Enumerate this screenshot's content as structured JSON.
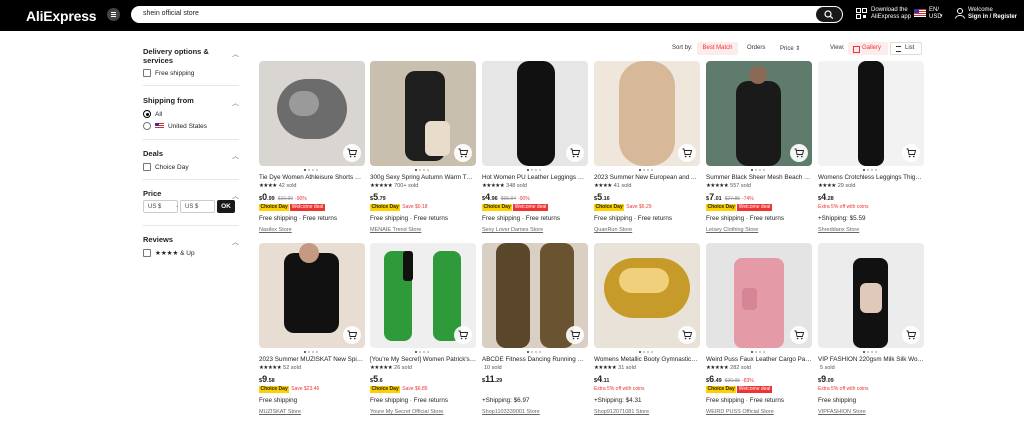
{
  "header": {
    "logo": "AliExpress",
    "search_value": "shein official store",
    "app_line1": "Download the",
    "app_line2": "AliExpress app",
    "lang": "EN/",
    "currency": "USD",
    "welcome": "Welcome",
    "signin": "Sign in / Register"
  },
  "sidebar": {
    "delivery_title_1": "Delivery options &",
    "delivery_title_2": "services",
    "free_shipping": "Free shipping",
    "ship_from_title": "Shipping from",
    "ship_all": "All",
    "ship_us": "United States",
    "deals_title": "Deals",
    "choice_day": "Choice Day",
    "price_title": "Price",
    "price_min_placeholder": "US $",
    "price_max_placeholder": "US $",
    "ok": "OK",
    "reviews_title": "Reviews",
    "reviews_opt": "★★★★ & Up"
  },
  "sortbar": {
    "sort_by": "Sort by:",
    "best_match": "Best Match",
    "orders": "Orders",
    "price": "Price ⇕",
    "view": "View:",
    "gallery": "Gallery",
    "list": "List"
  },
  "products": [
    {
      "title": "Tie Dye Women Athleisure Shorts S…",
      "stars": "★★★★",
      "sold": "42 sold",
      "cur": "$",
      "int": "0",
      "cents": ".99",
      "old": "$16.99",
      "disc": "-90%",
      "badge": "welcome",
      "save": "",
      "ship": "Free shipping · Free returns",
      "store": "Nasilex Store"
    },
    {
      "title": "300g Sexy Spring Autumn Warm Th…",
      "stars": "★★★★★",
      "sold": "700+ sold",
      "cur": "$",
      "int": "5",
      "cents": ".79",
      "old": "",
      "disc": "",
      "badge": "save",
      "save": "Save $0.18",
      "ship": "Free shipping · Free returns",
      "store": "MENAIE Trend Store"
    },
    {
      "title": "Hot Women PU Leather Leggings Bl…",
      "stars": "★★★★★",
      "sold": "348 sold",
      "cur": "$",
      "int": "4",
      "cents": ".96",
      "old": "$65.94",
      "disc": "-90%",
      "badge": "welcome",
      "save": "",
      "ship": "Free shipping · Free returns",
      "store": "Sexy Lover Dames Store"
    },
    {
      "title": "2023 Summer New European and A…",
      "stars": "★★★★",
      "sold": "41 sold",
      "cur": "$",
      "int": "5",
      "cents": ".16",
      "old": "",
      "disc": "",
      "badge": "save",
      "save": "Save $6.29",
      "ship": "Free shipping · Free returns",
      "store": "QuanRun Store"
    },
    {
      "title": "Summer Black Sheer Mesh Beach D…",
      "stars": "★★★★★",
      "sold": "557 sold",
      "cur": "$",
      "int": "7",
      "cents": ".01",
      "old": "$27.85",
      "disc": "-74%",
      "badge": "welcome",
      "save": "",
      "ship": "Free shipping · Free returns",
      "store": "Leisey Clothing Store"
    },
    {
      "title": "Womens Crotchless Leggings Thigh …",
      "stars": "★★★★",
      "sold": "29 sold",
      "cur": "$",
      "int": "4",
      "cents": ".28",
      "old": "",
      "disc": "",
      "badge": "extra",
      "save": "Extra 5% off with coins",
      "ship": "+Shipping: $5.59",
      "store": "Shreddanx Store"
    },
    {
      "title": "2023 Summer MUZISKAT New Spice…",
      "stars": "★★★★★",
      "sold": "52 sold",
      "cur": "$",
      "int": "9",
      "cents": ".58",
      "old": "",
      "disc": "",
      "badge": "save",
      "save": "Save $23.46",
      "ship": "Free shipping",
      "store": "MUZISKAT Store"
    },
    {
      "title": "[You're My Secret] Women Patrick's…",
      "stars": "★★★★★",
      "sold": "26 sold",
      "cur": "$",
      "int": "5",
      "cents": ".6",
      "old": "",
      "disc": "",
      "badge": "save",
      "save": "Save $6.85",
      "ship": "Free shipping · Free returns",
      "store": "Youre My Secret Official Store"
    },
    {
      "title": "ABCDE Fitness Dancing Running Cas…",
      "stars": "",
      "sold": "10 sold",
      "cur": "$",
      "int": "11",
      "cents": ".29",
      "old": "",
      "disc": "",
      "badge": "",
      "save": "",
      "ship": "+Shipping: $6.97",
      "store": "Shop1103339001 Store"
    },
    {
      "title": "Womens Metallic Booty Gymnastics …",
      "stars": "★★★★★",
      "sold": "31 sold",
      "cur": "$",
      "int": "4",
      "cents": ".11",
      "old": "",
      "disc": "",
      "badge": "extra",
      "save": "Extra 5% off with coins",
      "ship": "+Shipping: $4.31",
      "store": "Shop912071081 Store"
    },
    {
      "title": "Weird Puss Faux Leather Cargo Pan…",
      "stars": "★★★★★",
      "sold": "282 sold",
      "cur": "$",
      "int": "6",
      "cents": ".49",
      "old": "$39.05",
      "disc": "-83%",
      "badge": "welcome",
      "save": "",
      "ship": "Free shipping · Free returns",
      "store": "WEIRD PUSS Official Store"
    },
    {
      "title": "VIP FASHION 220gsm Milk Silk Wom…",
      "stars": "",
      "sold": "5 sold",
      "cur": "$",
      "int": "9",
      "cents": ".09",
      "old": "",
      "disc": "",
      "badge": "extra",
      "save": "Extra 5% off with coins",
      "ship": "Free shipping",
      "store": "VIPFASHION Store"
    }
  ],
  "badges": {
    "choice": "Choice Day",
    "welcome": "Welcome deal"
  },
  "icons": {
    "menu": "menu-icon",
    "search": "search-icon",
    "qr": "qr-code-icon",
    "user": "user-icon",
    "cart": "add-to-cart-icon"
  },
  "colors": {
    "accent": "#e33333",
    "header_bg": "#000000",
    "badge_yellow": "#fdd000"
  }
}
